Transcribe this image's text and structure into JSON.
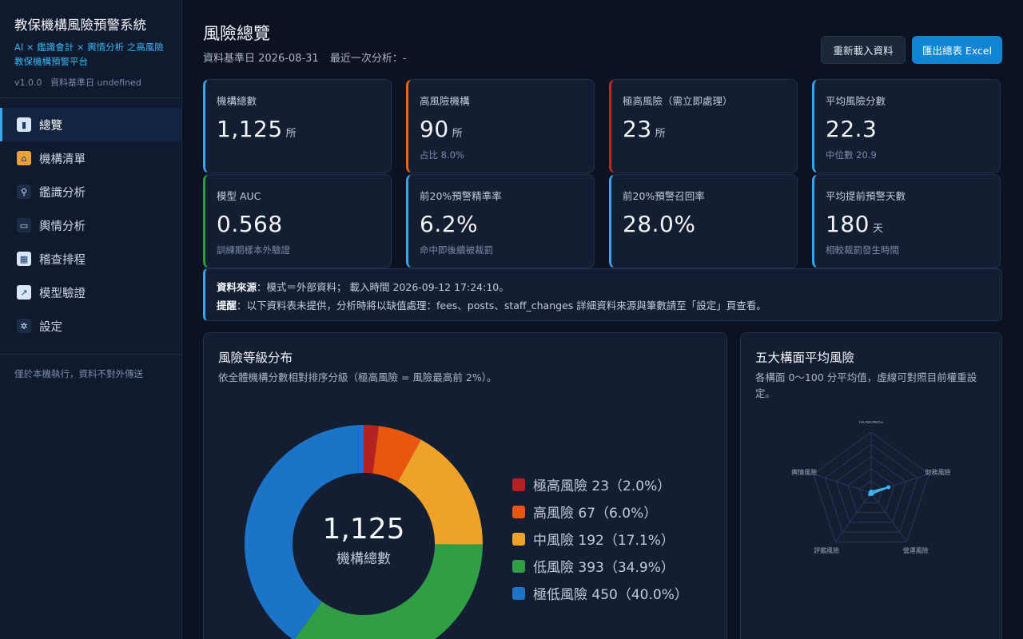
{
  "app": {
    "title": "教保機構風險預警系統",
    "subtitle": "AI × 鑑識會計 × 輿情分析 之高風險教保機構預警平台",
    "version": "v1.0.0",
    "base_date_label": "資料基準日 undefined"
  },
  "nav": [
    {
      "label": "總覽",
      "icon": "bar-chart-icon",
      "active": true
    },
    {
      "label": "機構清單",
      "icon": "school-icon",
      "active": false
    },
    {
      "label": "鑑識分析",
      "icon": "magnifier-icon",
      "active": false
    },
    {
      "label": "輿情分析",
      "icon": "speech-bubble-icon",
      "active": false
    },
    {
      "label": "稽查排程",
      "icon": "calendar-icon",
      "active": false
    },
    {
      "label": "模型驗證",
      "icon": "line-chart-icon",
      "active": false
    },
    {
      "label": "設定",
      "icon": "gear-icon",
      "active": false
    }
  ],
  "sidebar_footer": "僅於本機執行，資料不對外傳送",
  "header": {
    "title": "風險總覽",
    "base_date": "資料基準日 2026-08-31",
    "last_analysis": "最近一次分析：-",
    "reload_label": "重新載入資料",
    "export_label": "匯出總表 Excel"
  },
  "cards": [
    {
      "label": "機構總數",
      "value": "1,125",
      "unit": "所",
      "sub": "",
      "accent": "#3aa6e8"
    },
    {
      "label": "高風險機構",
      "value": "90",
      "unit": "所",
      "sub": "占比 8.0%",
      "accent": "#e8651a"
    },
    {
      "label": "極高風險（需立即處理）",
      "value": "23",
      "unit": "所",
      "sub": "",
      "accent": "#c62828"
    },
    {
      "label": "平均風險分數",
      "value": "22.3",
      "unit": "",
      "sub": "中位數 20.9",
      "accent": "#3aa6e8"
    },
    {
      "label": "模型 AUC",
      "value": "0.568",
      "unit": "",
      "sub": "訓練期樣本外驗證",
      "accent": "#2e9e44"
    },
    {
      "label": "前20%預警精準率",
      "value": "6.2%",
      "unit": "",
      "sub": "命中即後續被裁罰",
      "accent": "#3aa6e8"
    },
    {
      "label": "前20%預警召回率",
      "value": "28.0%",
      "unit": "",
      "sub": "",
      "accent": "#3aa6e8"
    },
    {
      "label": "平均提前預警天數",
      "value": "180",
      "unit": "天",
      "sub": "相較裁罰發生時間",
      "accent": "#3aa6e8"
    }
  ],
  "notice": {
    "source_label": "資料來源",
    "source_text": "：模式＝外部資料； 載入時間 2026-09-12 17:24:10。",
    "warn_label": "提醒",
    "warn_text": "：以下資料表未提供，分析時將以缺值處理：fees、posts、staff_changes 詳細資料來源與筆數請至「設定」頁查看。"
  },
  "chart_data": [
    {
      "type": "pie",
      "title": "風險等級分布",
      "subtitle": "依全體機構分數相對排序分級（極高風險 = 風險最高前 2%）。",
      "center_value": "1,125",
      "center_label": "機構總數",
      "slices": [
        {
          "name": "極高風險",
          "count": 23,
          "pct": "2.0%",
          "legend": "極高風險 23（2.0%）",
          "color": "#b52222"
        },
        {
          "name": "高風險",
          "count": 67,
          "pct": "6.0%",
          "legend": "高風險 67（6.0%）",
          "color": "#e8570f"
        },
        {
          "name": "中風險",
          "count": 192,
          "pct": "17.1%",
          "legend": "中風險 192（17.1%）",
          "color": "#efa22a"
        },
        {
          "name": "低風險",
          "count": 393,
          "pct": "34.9%",
          "legend": "低風險 393（34.9%）",
          "color": "#2f9e44"
        },
        {
          "name": "極低風險",
          "count": 450,
          "pct": "40.0%",
          "legend": "極低風險 450（40.0%）",
          "color": "#1c74c8"
        }
      ]
    },
    {
      "type": "radar",
      "title": "五大構面平均風險",
      "subtitle": "各構面 0～100 分平均值，虛線可對照目前權重設定。",
      "range": [
        0,
        100
      ],
      "axes": [
        "法遵風險",
        "財務風險",
        "營運風險",
        "評鑑風險",
        "輿情風險"
      ],
      "values": [
        2,
        30,
        2,
        3,
        1
      ],
      "series_color": "#3ab4f2"
    }
  ]
}
